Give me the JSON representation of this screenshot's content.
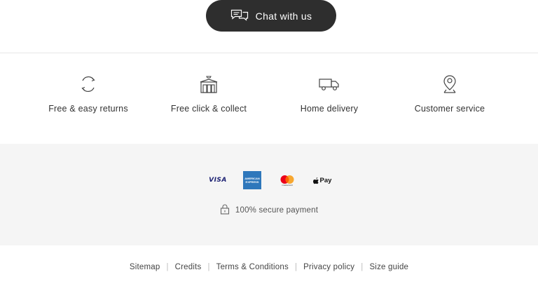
{
  "chat": {
    "label": "Chat with us",
    "icon": "chat-bubbles-icon"
  },
  "services": [
    {
      "label": "Free & easy returns",
      "icon": "returns-cycle-icon"
    },
    {
      "label": "Free click & collect",
      "icon": "store-icon"
    },
    {
      "label": "Home delivery",
      "icon": "delivery-truck-icon"
    },
    {
      "label": "Customer service",
      "icon": "location-pin-icon"
    }
  ],
  "payments": {
    "cards": [
      {
        "name": "Visa",
        "mark": "VISA"
      },
      {
        "name": "American Express",
        "mark": "AMERICAN EXPRESS"
      },
      {
        "name": "Mastercard",
        "mark": "mastercard"
      },
      {
        "name": "Apple Pay",
        "mark": "Pay"
      }
    ],
    "secure_label": "100% secure payment",
    "secure_icon": "lock-icon"
  },
  "footer": {
    "links": [
      "Sitemap",
      "Credits",
      "Terms & Conditions",
      "Privacy policy",
      "Size guide"
    ],
    "separator": "|"
  },
  "colors": {
    "chat_bg": "#2e2e2e",
    "payments_bg": "#f5f5f5",
    "amex_blue": "#2e77bb",
    "mc_red": "#eb001b",
    "mc_yellow": "#f79e1b",
    "visa_blue": "#1a1f71"
  }
}
